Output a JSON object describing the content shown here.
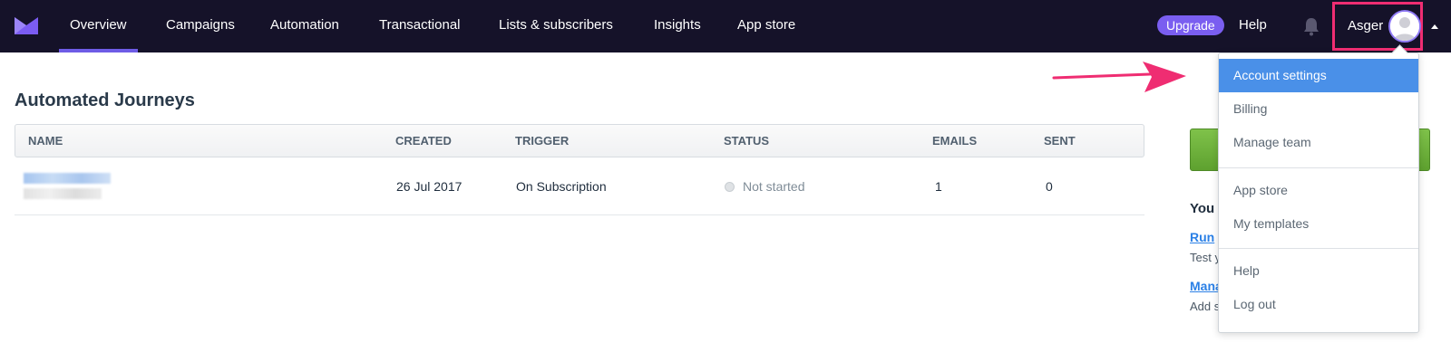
{
  "nav": {
    "items": [
      {
        "label": "Overview",
        "active": true
      },
      {
        "label": "Campaigns"
      },
      {
        "label": "Automation"
      },
      {
        "label": "Transactional"
      },
      {
        "label": "Lists & subscribers"
      },
      {
        "label": "Insights"
      },
      {
        "label": "App store"
      }
    ],
    "upgrade_label": "Upgrade",
    "help_label": "Help",
    "user_name": "Asger",
    "accent": "#6e5ce6",
    "bg": "#151229"
  },
  "page": {
    "title": "Automated Journeys"
  },
  "table": {
    "headers": [
      "NAME",
      "CREATED",
      "TRIGGER",
      "STATUS",
      "EMAILS",
      "SENT"
    ],
    "rows": [
      {
        "name": "",
        "created": "26 Jul 2017",
        "trigger": "On Subscription",
        "status": "Not started",
        "emails": "1",
        "sent": "0"
      }
    ]
  },
  "side": {
    "heading": "You",
    "link1": "Run",
    "text1": "Test y",
    "link2": "Mana",
    "text2": "Add s"
  },
  "dropdown": {
    "items": [
      {
        "label": "Account settings",
        "selected": true
      },
      {
        "label": "Billing"
      },
      {
        "label": "Manage team"
      },
      {
        "label": "App store"
      },
      {
        "label": "My templates"
      },
      {
        "label": "Help"
      },
      {
        "label": "Log out"
      }
    ],
    "highlight_color": "#4a90e8"
  },
  "annotation": {
    "highlight_color": "#ef2d72"
  }
}
